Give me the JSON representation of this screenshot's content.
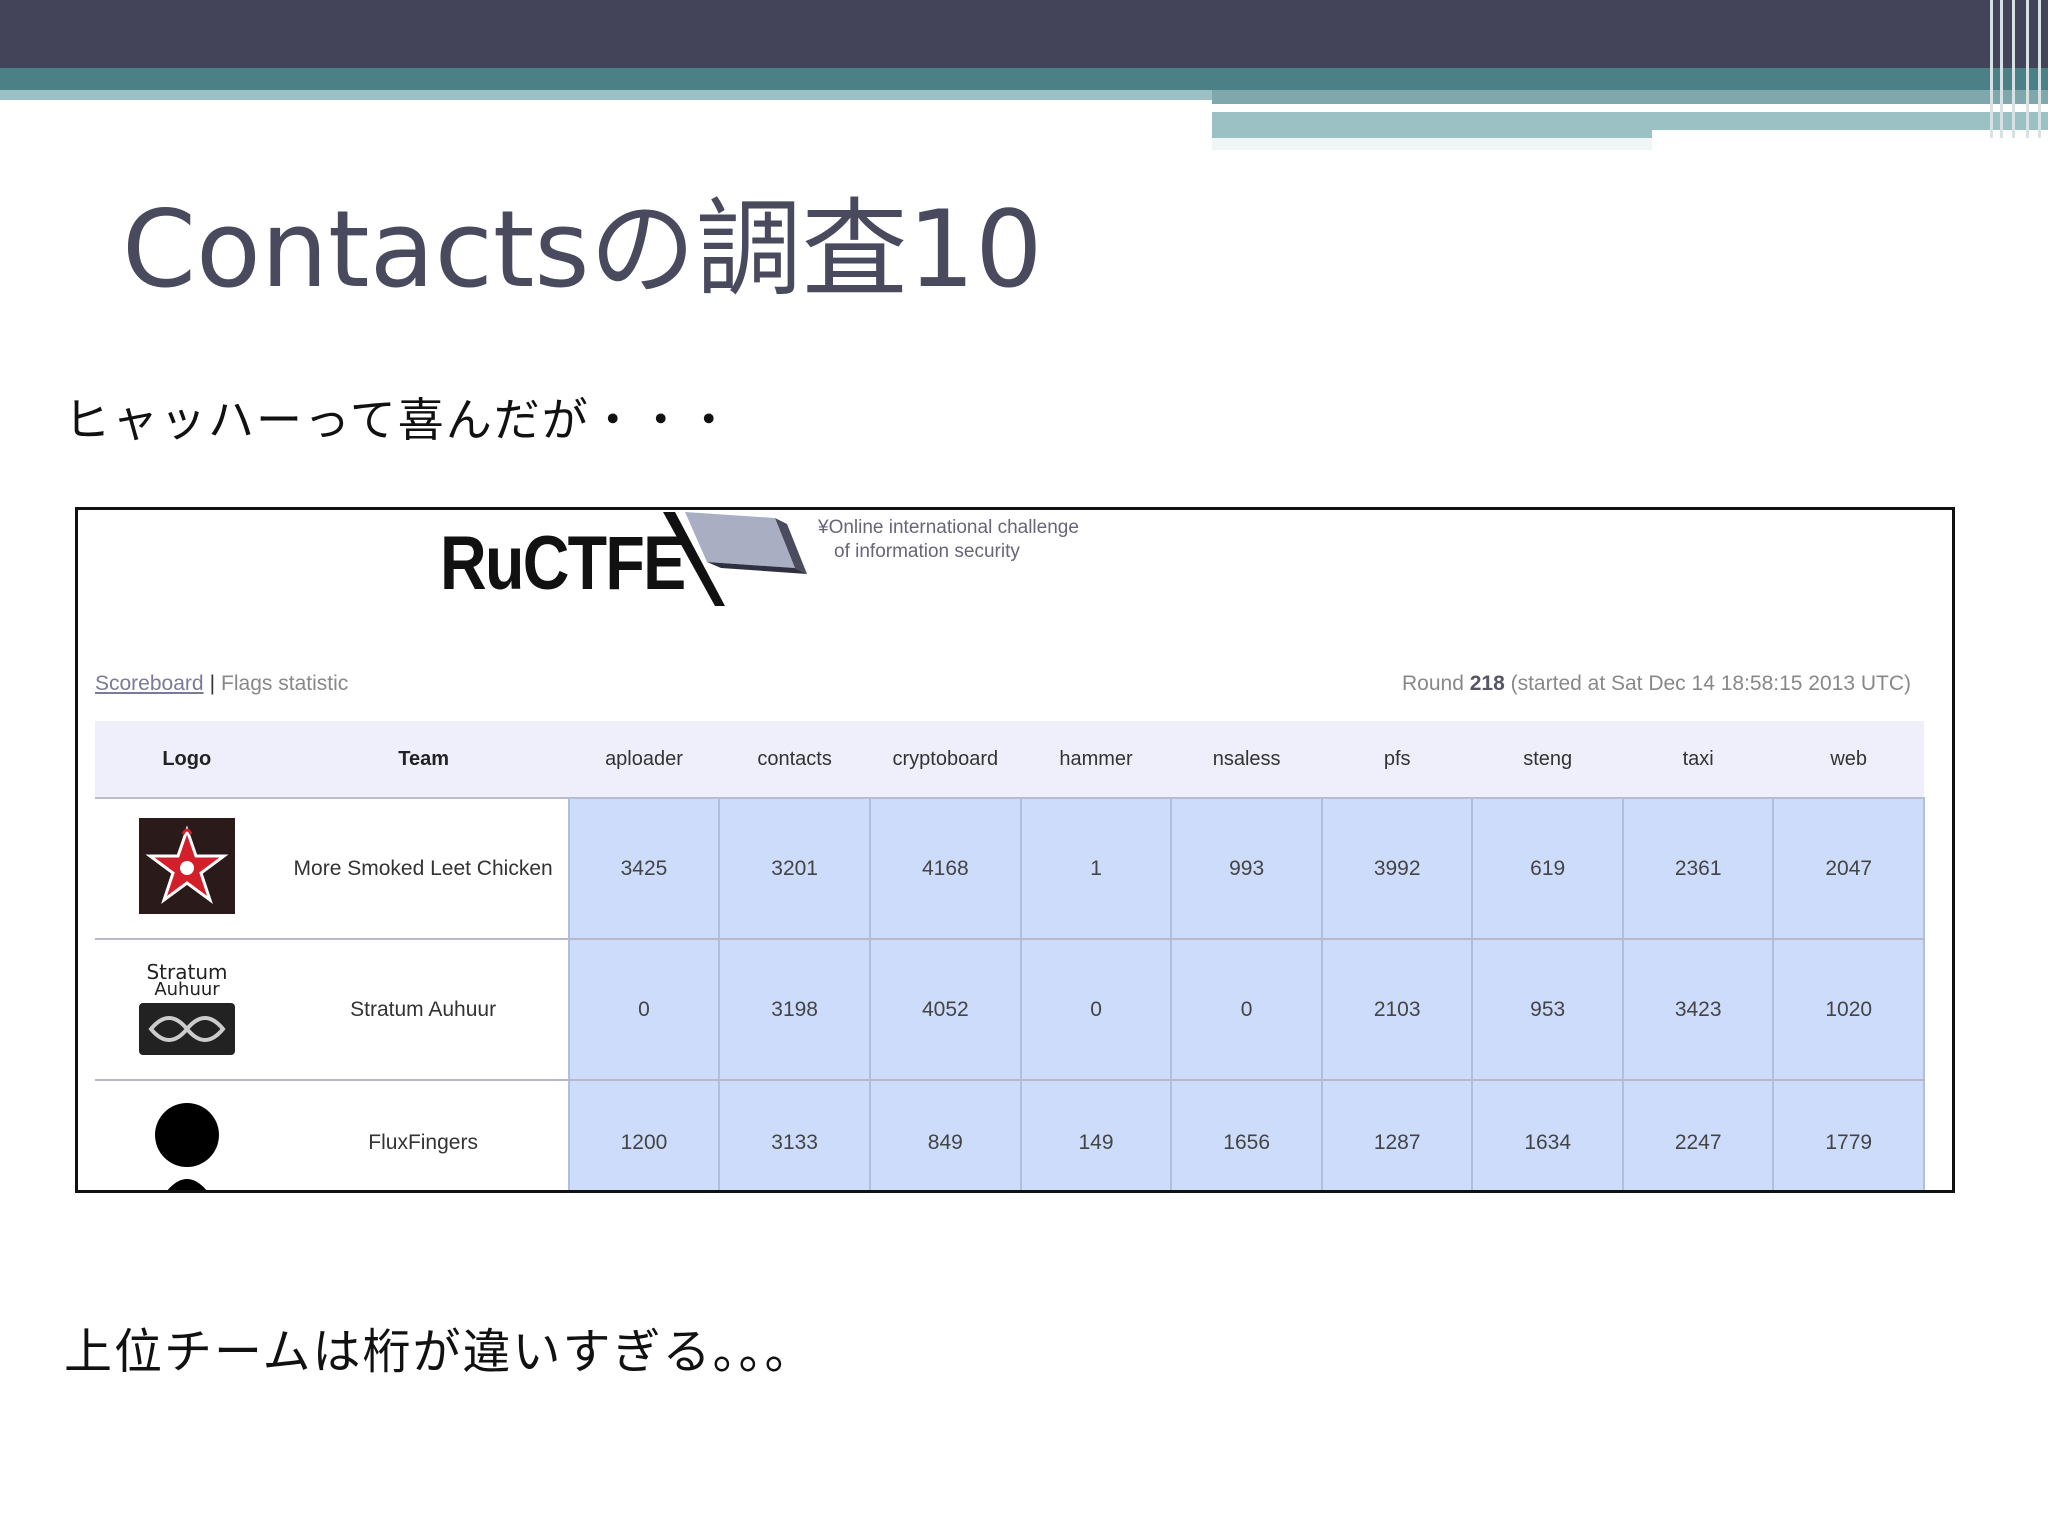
{
  "slide": {
    "title": "Contactsの調査10",
    "subtitle": "ヒャッハーって喜んだが・・・",
    "bottom_text": "上位チームは桁が違いすぎる。。。"
  },
  "screenshot": {
    "logo_text": "RuCTFE",
    "tagline_line1": "¥Online international challenge",
    "tagline_line2": "of information security",
    "nav": {
      "scoreboard": "Scoreboard",
      "separator": "|",
      "flags": "Flags statistic"
    },
    "round": {
      "label": "Round",
      "number": "218",
      "started": "(started at Sat Dec 14 18:58:15 2013 UTC)"
    },
    "table": {
      "headers": [
        "Logo",
        "Team",
        "aploader",
        "contacts",
        "cryptoboard",
        "hammer",
        "nsaless",
        "pfs",
        "steng",
        "taxi",
        "web"
      ],
      "rows": [
        {
          "team": "More Smoked Leet Chicken",
          "logo": "star-chicken-logo",
          "scores": [
            "3425",
            "3201",
            "4168",
            "1",
            "993",
            "3992",
            "619",
            "2361",
            "2047"
          ]
        },
        {
          "team": "Stratum Auhuur",
          "logo": "stratum-auhuur-logo",
          "logo_caption": "Stratum Auhuur",
          "scores": [
            "0",
            "3198",
            "4052",
            "0",
            "0",
            "2103",
            "953",
            "3423",
            "1020"
          ]
        },
        {
          "team": "FluxFingers",
          "logo": "person-silhouette-logo",
          "scores": [
            "1200",
            "3133",
            "849",
            "149",
            "1656",
            "1287",
            "1634",
            "2247",
            "1779"
          ]
        }
      ]
    }
  }
}
